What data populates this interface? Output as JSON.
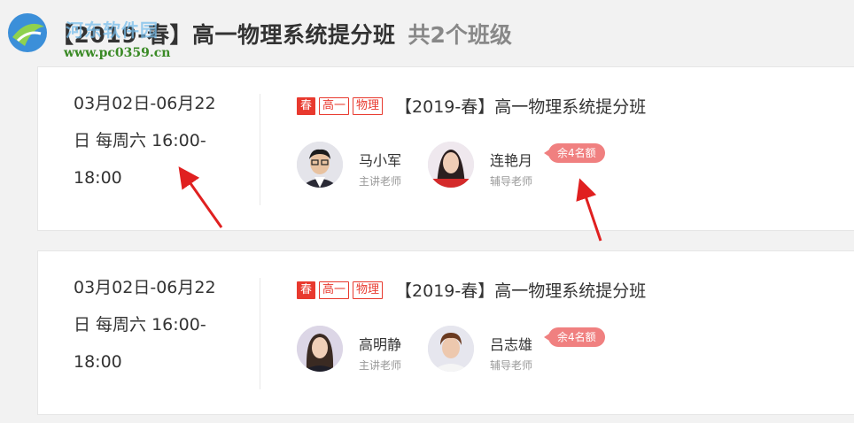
{
  "watermark": {
    "site_name": "河东软件园",
    "url": "www.pc0359.cn"
  },
  "header": {
    "title": "【2019-春】高一物理系统提分班",
    "count": "共2个班级"
  },
  "classes": [
    {
      "schedule": [
        "03月02日-06月22",
        "日 每周六 16:00-",
        "18:00"
      ],
      "tags": [
        "春",
        "高一",
        "物理"
      ],
      "course_name": "【2019-春】高一物理系统提分班",
      "teachers": [
        {
          "name": "马小军",
          "role": "主讲老师"
        },
        {
          "name": "连艳月",
          "role": "辅导老师",
          "badge": "余4名额"
        }
      ]
    },
    {
      "schedule": [
        "03月02日-06月22",
        "日 每周六 16:00-",
        "18:00"
      ],
      "tags": [
        "春",
        "高一",
        "物理"
      ],
      "course_name": "【2019-春】高一物理系统提分班",
      "teachers": [
        {
          "name": "高明静",
          "role": "主讲老师"
        },
        {
          "name": "吕志雄",
          "role": "辅导老师",
          "badge": "余4名额"
        }
      ]
    }
  ],
  "colors": {
    "accent": "#e8392e",
    "badge": "#f08080",
    "annotation_arrow": "#e02020"
  }
}
